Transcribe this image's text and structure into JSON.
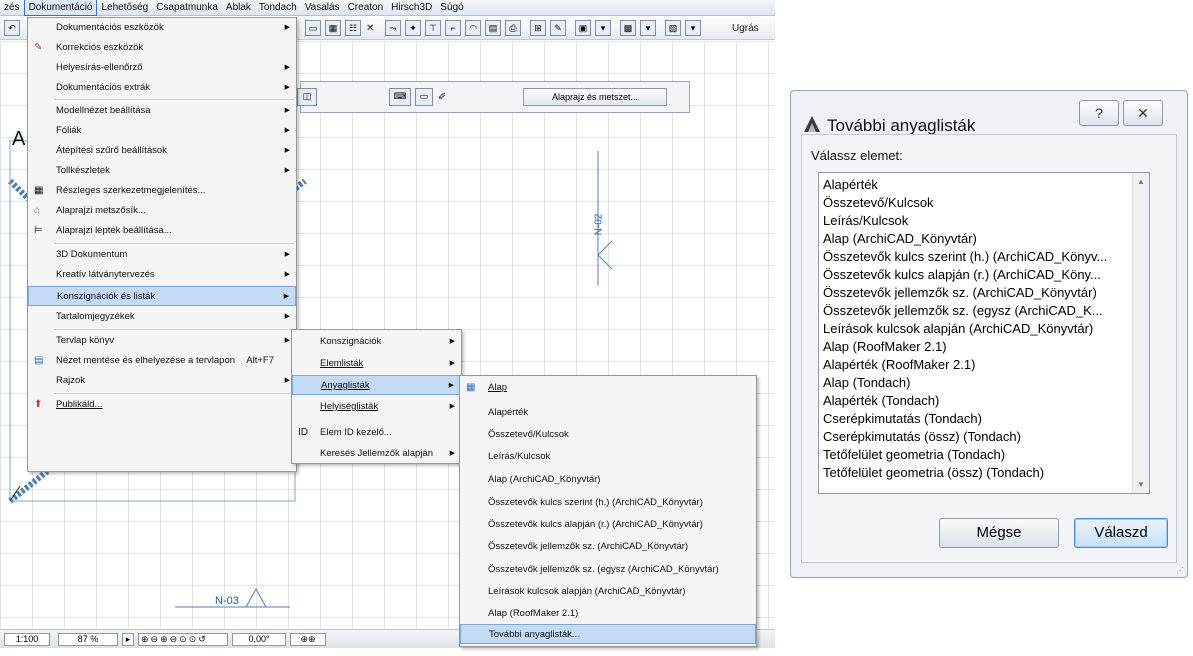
{
  "menubar": {
    "items": [
      "zés",
      "Dokumentáció",
      "Lehetőség",
      "Csapatmunka",
      "Ablak",
      "Tondach",
      "Vasalás",
      "Creaton",
      "Hirsch3D",
      "Súgó"
    ]
  },
  "toolbar": {
    "goto_label": "Ugrás"
  },
  "infobox": {
    "button_label": "Alaprajz és metszet..."
  },
  "canvas": {
    "letter": "A",
    "label_n02": "N-02",
    "label_n03": "N-03"
  },
  "statusbar": {
    "scale": "1:100",
    "zoom": "87 %",
    "angle": "0,00°"
  },
  "menu_main": {
    "items": [
      {
        "label": "Dokumentációs eszközök",
        "arrow": true
      },
      {
        "label": "Korrekciós eszközök",
        "icon": "pen-icon"
      },
      {
        "label": "Helyesírás-ellenőrző",
        "arrow": true
      },
      {
        "label": "Dokumentációs extrák",
        "arrow": true
      },
      {
        "label": "Modellnézet beállítása",
        "arrow": true
      },
      {
        "label": "Fóliák",
        "arrow": true
      },
      {
        "label": "Átépítési szűrő beállítások",
        "arrow": true
      },
      {
        "label": "Tollkészletek",
        "arrow": true
      },
      {
        "label": "Részleges szerkezetmegjelenítés...",
        "icon": "grid-icon"
      },
      {
        "label": "Alaprajzi metszősík...",
        "icon": "cut-plane-icon"
      },
      {
        "label": "Alaprajzi lépték beállítása...",
        "icon": "scale-icon"
      },
      {
        "label": "3D Dokumentum",
        "arrow": true
      },
      {
        "label": "Kreatív látványtervezés",
        "arrow": true
      },
      {
        "label": "Konszignációk és listák",
        "arrow": true,
        "highlight": true
      },
      {
        "label": "Tartalomjegyzékek",
        "arrow": true
      },
      {
        "label": "Tervlap könyv",
        "arrow": true
      },
      {
        "label": "Nézet mentése és elhelyezése a tervlapon",
        "shortcut": "Alt+F7",
        "icon": "save-view-icon"
      },
      {
        "label": "Rajzok",
        "arrow": true
      },
      {
        "label": "Publikáld...",
        "icon": "publish-icon"
      }
    ]
  },
  "menu_sub1": {
    "items": [
      {
        "label": "Konszignációk",
        "arrow": true
      },
      {
        "label": "Elemlisták",
        "arrow": true
      },
      {
        "label": "Anyaglisták",
        "arrow": true,
        "highlight": true
      },
      {
        "label": "Helyiséglisták",
        "arrow": true
      },
      {
        "label": "Elem ID kezelő...",
        "icon": "id-icon"
      },
      {
        "label": "Keresés Jellemzők alapján",
        "arrow": true
      }
    ]
  },
  "menu_sub2": {
    "items": [
      {
        "label": "Alap",
        "icon": "table-icon"
      },
      {
        "label": "Alapérték"
      },
      {
        "label": "Összetevő/Kulcsok"
      },
      {
        "label": "Leírás/Kulcsok"
      },
      {
        "label": "Alap (ArchiCAD_Könyvtár)"
      },
      {
        "label": "Összetevők kulcs szerint (h.) (ArchiCAD_Könyvtár)"
      },
      {
        "label": "Összetevők kulcs alapján (r.) (ArchiCAD_Könyvtár)"
      },
      {
        "label": "Összetevők jellemzők sz. (ArchiCAD_Könyvtár)"
      },
      {
        "label": "Összetevők jellemzők sz. (egysz (ArchiCAD_Könyvtár)"
      },
      {
        "label": "Leírások kulcsok alapján (ArchiCAD_Könyvtár)"
      },
      {
        "label": "Alap (RoofMaker 2.1)"
      },
      {
        "label": "További anyaglisták...",
        "highlight": true
      }
    ]
  },
  "dialog": {
    "title": "További anyaglisták",
    "help_label": "?",
    "close_label": "✕",
    "prompt": "Válassz elemet:",
    "list": [
      "Alapérték",
      "Összetevő/Kulcsok",
      "Leírás/Kulcsok",
      "Alap (ArchiCAD_Könyvtár)",
      "Összetevők kulcs szerint (h.) (ArchiCAD_Könyv...",
      "Összetevők kulcs alapján (r.) (ArchiCAD_Köny...",
      "Összetevők jellemzők sz. (ArchiCAD_Könyvtár)",
      "Összetevők jellemzők sz. (egysz (ArchiCAD_K...",
      "Leírások kulcsok alapján (ArchiCAD_Könyvtár)",
      "Alap (RoofMaker 2.1)",
      "Alapérték (RoofMaker 2.1)",
      "Alap (Tondach)",
      "Alapérték (Tondach)",
      "Cserépkimutatás (Tondach)",
      "Cserépkimutatás (össz) (Tondach)",
      "Tetőfelület geometria (Tondach)",
      "Tetőfelület geometria (össz) (Tondach)"
    ],
    "cancel_label": "Mégse",
    "ok_label": "Válaszd"
  }
}
